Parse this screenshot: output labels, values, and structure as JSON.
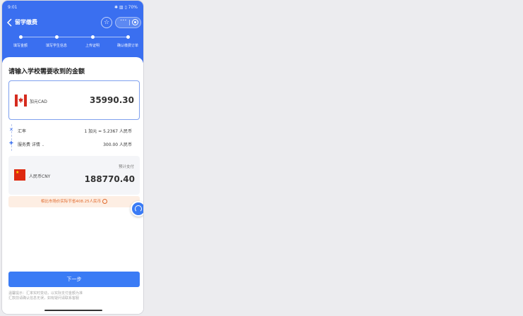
{
  "status_bar": {
    "time": "9:01",
    "icons": "✱ ▥ ▯ 70%"
  },
  "nav": {
    "title": "留学缴费"
  },
  "steps": [
    {
      "label": "填写金额"
    },
    {
      "label": "填写学生信息"
    },
    {
      "label": "上传证明"
    },
    {
      "label": "确认缴费订单"
    }
  ],
  "prompt": "请输入学校需要收到的金额",
  "send": {
    "currency_label": "加元CAD",
    "amount": "35990.30"
  },
  "fees": {
    "rate_label": "汇率",
    "rate_value": "1 加元 = 5.2367 人民币",
    "service_label": "服务费 详情",
    "service_value": "300.00 人民币"
  },
  "receive": {
    "label": "预计支付",
    "currency_label": "人民币CNY",
    "amount": "188770.40"
  },
  "savings": "相比市场价实际节省408.25人民币",
  "next_button": "下一步",
  "disclaimer": [
    "温馨提示：汇率实时变动，以实际支付金额为准",
    "汇款前请确认信息无误，如有疑问请联系客服"
  ],
  "colors": {
    "brand_blue": "#3a6ff0",
    "accent_orange": "#e0682a",
    "flag_red": "#d52b1e"
  }
}
